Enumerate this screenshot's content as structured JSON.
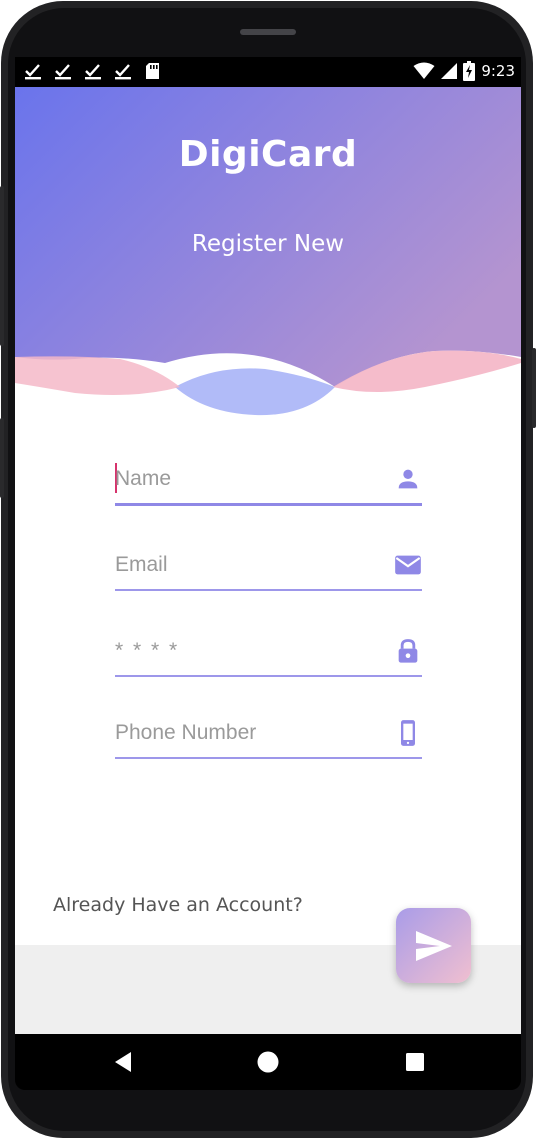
{
  "statusbar": {
    "left_icons": [
      "download-done-icon",
      "download-done-icon",
      "download-done-icon",
      "download-done-icon",
      "sd-card-icon"
    ],
    "right_icons": [
      "wifi-icon",
      "cell-signal-icon",
      "battery-charging-icon"
    ],
    "time": "9:23"
  },
  "header": {
    "title": "DigiCard",
    "subtitle": "Register New",
    "gradient_start": "#6a74ec",
    "gradient_end": "#b494d0",
    "wave_colors": [
      "#f4b8c8",
      "#a9b4f7"
    ]
  },
  "form": {
    "name_placeholder": "Name",
    "email_placeholder": "Email",
    "password_placeholder": "* * * *",
    "phone_placeholder": "Phone Number",
    "accent": "#8f88e6",
    "icons": [
      "person-icon",
      "mail-icon",
      "lock-icon",
      "smartphone-icon"
    ]
  },
  "footer": {
    "login_link": "Already Have an Account?",
    "send_icon": "send-icon"
  },
  "navbar": {
    "icons": [
      "back-icon",
      "home-icon",
      "recents-icon"
    ]
  }
}
